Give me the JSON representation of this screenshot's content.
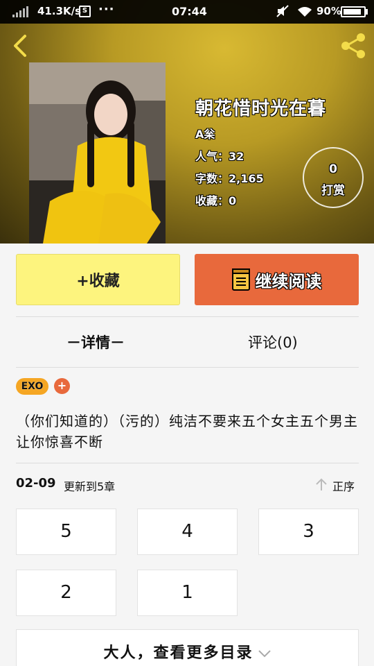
{
  "status_bar": {
    "speed": "41.3K/s",
    "s_icon": "S",
    "dots": "···",
    "time": "07:44",
    "battery_pct": "90%",
    "battery_level": 0.9
  },
  "book": {
    "title": "朝花惜时光在暮",
    "author": "A枀",
    "popularity": "人气：32",
    "words": "字数：2,165",
    "favorites": "收藏：0",
    "tip_count": "0",
    "tip_label": "打赏"
  },
  "actions": {
    "collect": "+收藏",
    "read": "继续阅读"
  },
  "tabs": {
    "detail": "－详情－",
    "comment": "评论(0)"
  },
  "tags": [
    "EXO"
  ],
  "tag_add": "+",
  "description": "（你们知道的）（污的）纯洁不要来五个女主五个男主让你惊喜不断",
  "update": {
    "date": "02-09",
    "text": "更新到5章",
    "sort": "正序"
  },
  "chapters": [
    "5",
    "4",
    "3",
    "2",
    "1"
  ],
  "more": "大人，查看更多目录",
  "colors": {
    "collect_bg": "#fdf47e",
    "read_bg": "#e8693c",
    "tag_bg": "#f5a623"
  }
}
